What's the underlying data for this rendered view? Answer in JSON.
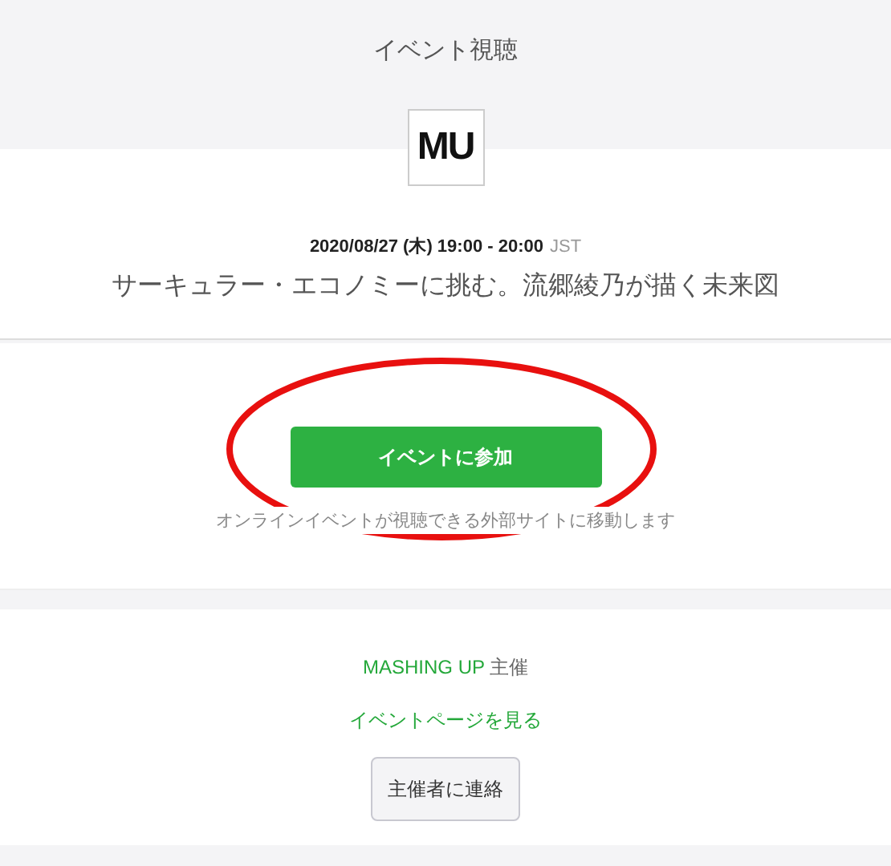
{
  "header": {
    "title": "イベント視聴"
  },
  "logo": {
    "text": "MU"
  },
  "event": {
    "date": "2020/08/27 (木) 19:00 - 20:00",
    "timezone": "JST",
    "title": "サーキュラー・エコノミーに挑む。流郷綾乃が描く未来図"
  },
  "join": {
    "button": "イベントに参加",
    "note": "オンラインイベントが視聴できる外部サイトに移動します",
    "highlighted": true
  },
  "organizer": {
    "name": "MASHING UP",
    "suffix": "主催",
    "page_link": "イベントページを見る",
    "contact_button": "主催者に連絡"
  }
}
